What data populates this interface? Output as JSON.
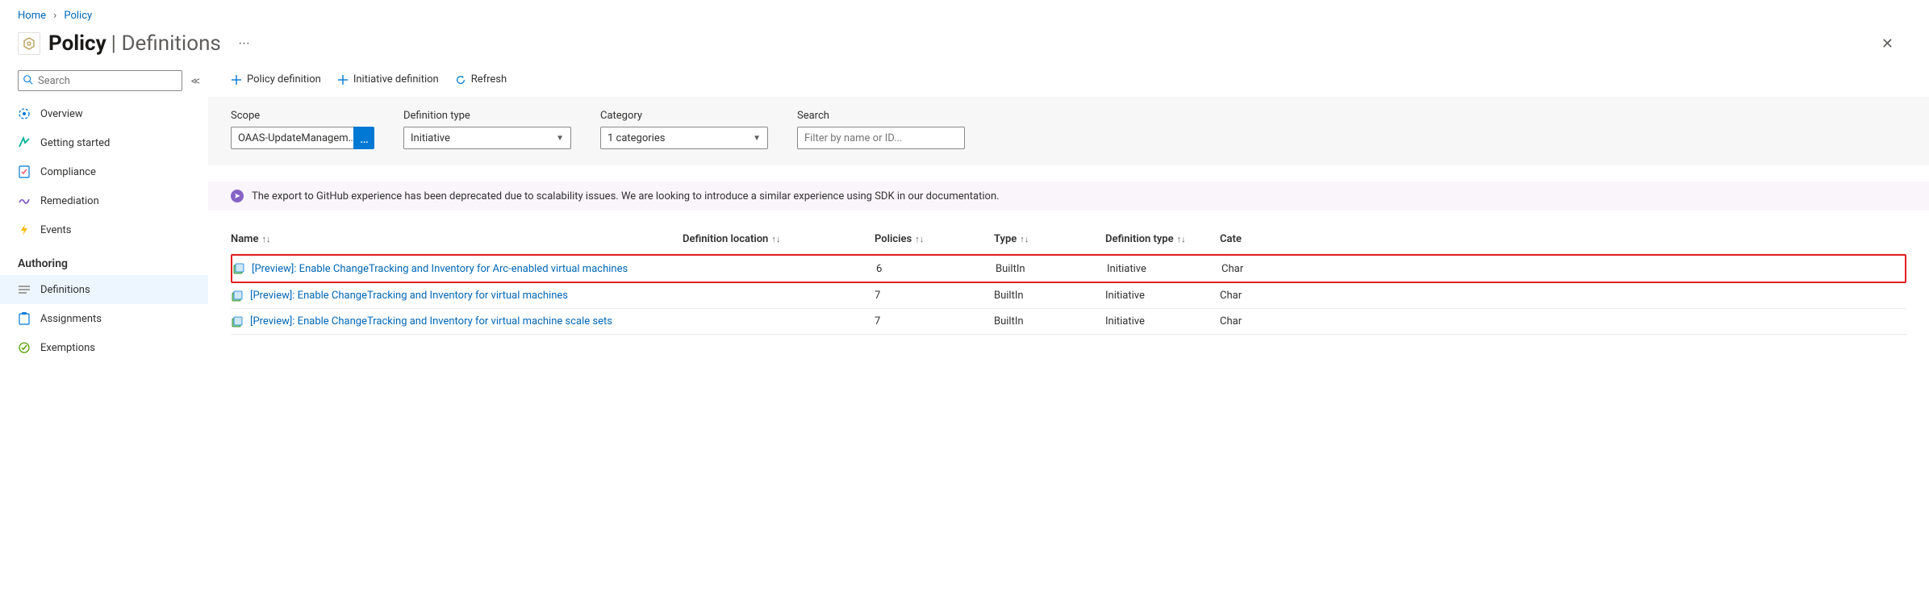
{
  "breadcrumb": {
    "home": "Home",
    "current": "Policy"
  },
  "header": {
    "title": "Policy",
    "subtitle": "Definitions"
  },
  "sidebar": {
    "search_placeholder": "Search",
    "items": [
      {
        "label": "Overview"
      },
      {
        "label": "Getting started"
      },
      {
        "label": "Compliance"
      },
      {
        "label": "Remediation"
      },
      {
        "label": "Events"
      }
    ],
    "section": "Authoring",
    "authoring": [
      {
        "label": "Definitions"
      },
      {
        "label": "Assignments"
      },
      {
        "label": "Exemptions"
      }
    ]
  },
  "toolbar": {
    "policy_def": "Policy definition",
    "initiative_def": "Initiative definition",
    "refresh": "Refresh"
  },
  "filters": {
    "scope_label": "Scope",
    "scope_value": "OAAS-UpdateManagem…",
    "deftype_label": "Definition type",
    "deftype_value": "Initiative",
    "category_label": "Category",
    "category_value": "1 categories",
    "search_label": "Search",
    "search_placeholder": "Filter by name or ID..."
  },
  "notice": "The export to GitHub experience has been deprecated due to scalability issues. We are looking to introduce a similar experience using SDK in our documentation.",
  "table": {
    "headers": {
      "name": "Name",
      "location": "Definition location",
      "policies": "Policies",
      "type": "Type",
      "deftype": "Definition type",
      "category": "Cate"
    },
    "rows": [
      {
        "name": "[Preview]: Enable ChangeTracking and Inventory for Arc-enabled virtual machines",
        "location": "",
        "policies": "6",
        "type": "BuiltIn",
        "deftype": "Initiative",
        "category": "Char",
        "highlighted": true
      },
      {
        "name": "[Preview]: Enable ChangeTracking and Inventory for virtual machines",
        "location": "",
        "policies": "7",
        "type": "BuiltIn",
        "deftype": "Initiative",
        "category": "Char",
        "highlighted": false
      },
      {
        "name": "[Preview]: Enable ChangeTracking and Inventory for virtual machine scale sets",
        "location": "",
        "policies": "7",
        "type": "BuiltIn",
        "deftype": "Initiative",
        "category": "Char",
        "highlighted": false
      }
    ]
  }
}
